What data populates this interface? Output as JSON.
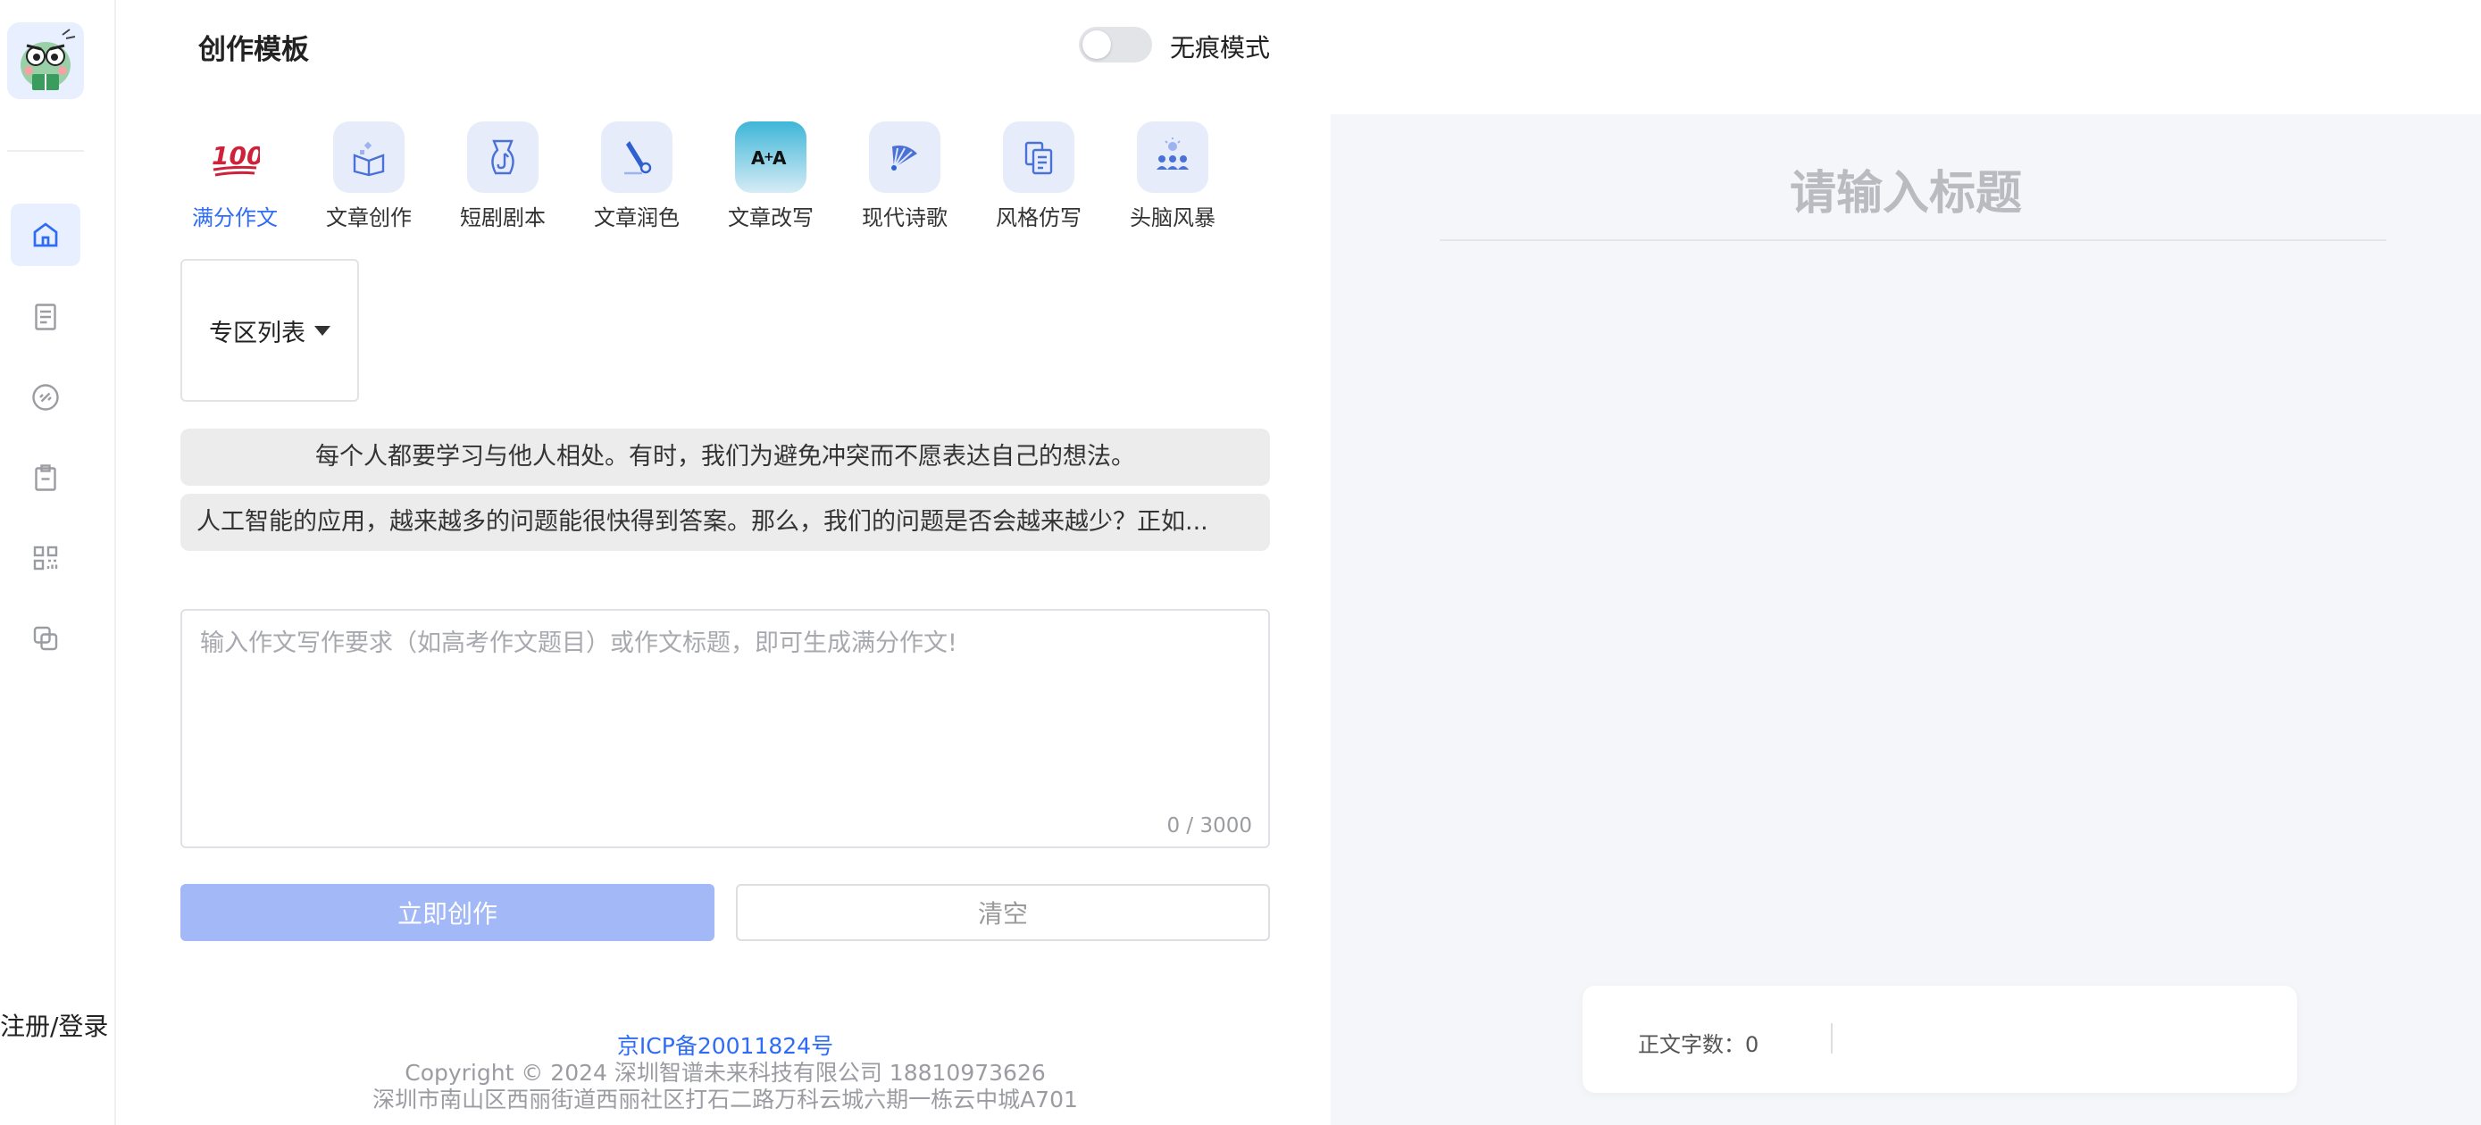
{
  "sidebar": {
    "logo_icon": "cartoon-character-logo-icon",
    "nav": [
      {
        "name": "home",
        "icon": "home-icon",
        "active": true
      },
      {
        "name": "documents",
        "icon": "document-list-icon",
        "active": false
      },
      {
        "name": "links",
        "icon": "link-icon",
        "active": false
      },
      {
        "name": "clipboard",
        "icon": "clipboard-icon",
        "active": false
      },
      {
        "name": "apps",
        "icon": "apps-grid-icon",
        "active": false
      },
      {
        "name": "copy",
        "icon": "copy-icon",
        "active": false
      }
    ],
    "login_label": "注册/登录"
  },
  "header": {
    "title": "创作模板",
    "incognito_label": "无痕模式",
    "incognito_on": false
  },
  "tabs": [
    {
      "label": "满分作文",
      "icon": "hundred-points-icon",
      "active": true
    },
    {
      "label": "文章创作",
      "icon": "open-book-icon",
      "active": false
    },
    {
      "label": "短剧剧本",
      "icon": "music-vase-icon",
      "active": false
    },
    {
      "label": "文章润色",
      "icon": "pen-brush-icon",
      "active": false
    },
    {
      "label": "文章改写",
      "icon": "translate-aa-icon",
      "active": false
    },
    {
      "label": "现代诗歌",
      "icon": "fan-icon",
      "active": false
    },
    {
      "label": "风格仿写",
      "icon": "copy-documents-icon",
      "active": false
    },
    {
      "label": "头脑风暴",
      "icon": "brainstorm-people-icon",
      "active": false
    }
  ],
  "zone_select": {
    "label": "专区列表"
  },
  "suggestions": [
    "每个人都要学习与他人相处。有时，我们为避免冲突而不愿表达自己的想法。",
    "人工智能的应用，越来越多的问题能很快得到答案。那么，我们的问题是否会越来越少？正如..."
  ],
  "prompt": {
    "placeholder": "输入作文写作要求（如高考作文题目）或作文标题，即可生成满分作文!",
    "value": "",
    "counter": "0 / 3000"
  },
  "buttons": {
    "create": "立即创作",
    "clear": "清空"
  },
  "footer": {
    "icp": "京ICP备20011824号",
    "copyright": "Copyright © 2024 深圳智谱未来科技有限公司 18810973626",
    "address": "深圳市南山区西丽街道西丽社区打石二路万科云城六期一栋云中城A701"
  },
  "editor": {
    "title_placeholder": "请输入标题",
    "word_count_label": "正文字数：0"
  },
  "colors": {
    "accent": "#2f6cf6",
    "create_button": "#a3b8f7",
    "panel_bg": "#f5f6fa"
  }
}
